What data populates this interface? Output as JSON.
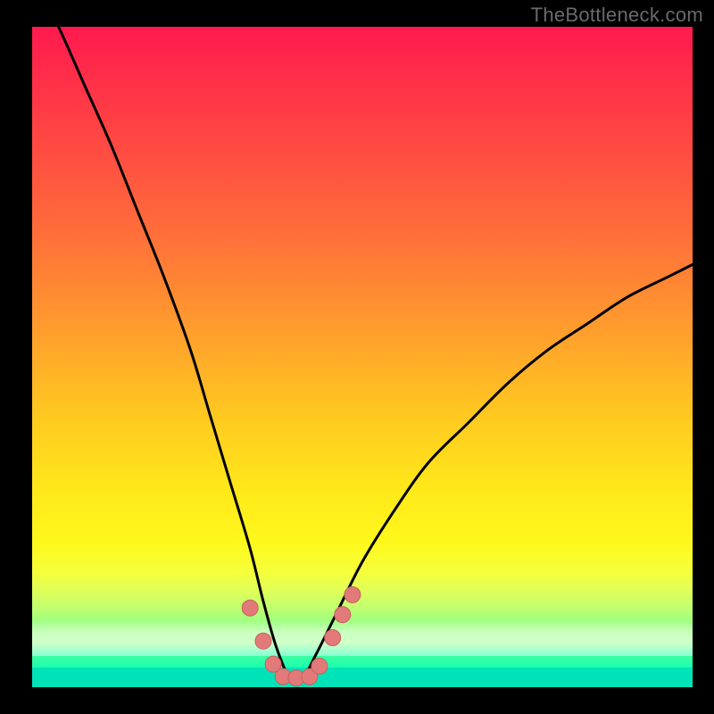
{
  "watermark": "TheBottleneck.com",
  "colors": {
    "background": "#000000",
    "curve_stroke": "#000000",
    "marker_fill": "#e27a7a",
    "marker_stroke": "#c76060",
    "gradient_top": "#ff1a4f",
    "gradient_bottom": "#00e8b9"
  },
  "chart_data": {
    "type": "line",
    "title": "",
    "xlabel": "",
    "ylabel": "",
    "xlim": [
      0,
      100
    ],
    "ylim": [
      0,
      100
    ],
    "grid": false,
    "legend": false,
    "annotations": [
      "TheBottleneck.com"
    ],
    "background": "red-to-green vertical gradient (bottleneck severity)",
    "series": [
      {
        "name": "bottleneck-curve",
        "x": [
          0,
          4,
          8,
          12,
          16,
          20,
          24,
          27,
          30,
          33,
          35,
          37,
          39,
          41,
          43,
          46,
          50,
          55,
          60,
          66,
          72,
          78,
          84,
          90,
          96,
          100
        ],
        "y": [
          108,
          100,
          91,
          82,
          72,
          62,
          51,
          41,
          31,
          21,
          13,
          6,
          1.5,
          1.5,
          5,
          11,
          19,
          27,
          34,
          40,
          46,
          51,
          55,
          59,
          62,
          64
        ]
      }
    ],
    "markers": [
      {
        "x": 33.0,
        "y": 12.0
      },
      {
        "x": 35.0,
        "y": 7.0
      },
      {
        "x": 36.5,
        "y": 3.5
      },
      {
        "x": 38.0,
        "y": 1.6
      },
      {
        "x": 40.0,
        "y": 1.4
      },
      {
        "x": 42.0,
        "y": 1.6
      },
      {
        "x": 43.5,
        "y": 3.2
      },
      {
        "x": 45.5,
        "y": 7.5
      },
      {
        "x": 47.0,
        "y": 11.0
      },
      {
        "x": 48.5,
        "y": 14.0
      }
    ]
  }
}
